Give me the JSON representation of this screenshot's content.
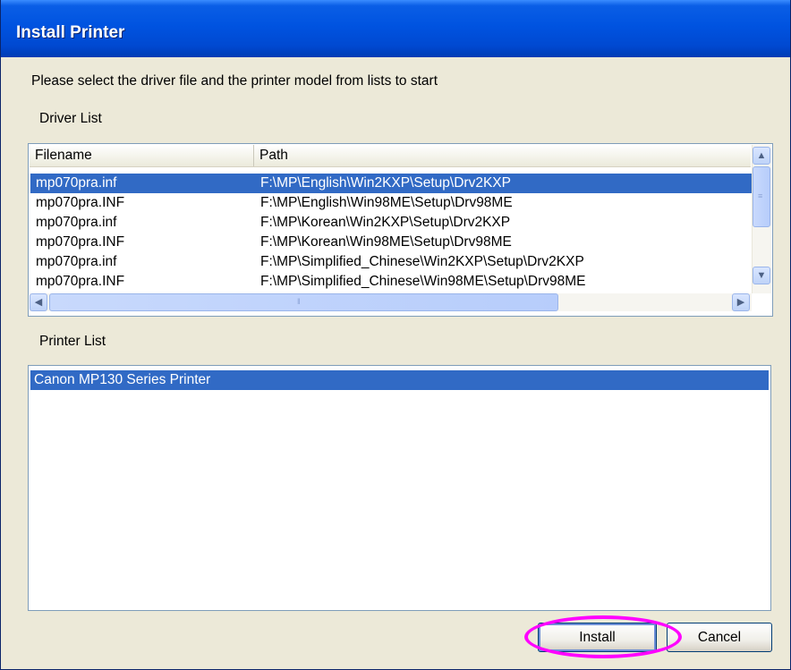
{
  "window": {
    "title": "Install Printer"
  },
  "instruction": "Please select the driver file and the printer model from lists to start",
  "driver_list": {
    "label": "Driver List",
    "columns": [
      "Filename",
      "Path"
    ],
    "rows": [
      {
        "filename": "mp070pra.inf",
        "path": "F:\\MP\\English\\Win2KXP\\Setup\\Drv2KXP",
        "selected": true
      },
      {
        "filename": "mp070pra.INF",
        "path": "F:\\MP\\English\\Win98ME\\Setup\\Drv98ME",
        "selected": false
      },
      {
        "filename": "mp070pra.inf",
        "path": "F:\\MP\\Korean\\Win2KXP\\Setup\\Drv2KXP",
        "selected": false
      },
      {
        "filename": "mp070pra.INF",
        "path": "F:\\MP\\Korean\\Win98ME\\Setup\\Drv98ME",
        "selected": false
      },
      {
        "filename": "mp070pra.inf",
        "path": "F:\\MP\\Simplified_Chinese\\Win2KXP\\Setup\\Drv2KXP",
        "selected": false
      },
      {
        "filename": "mp070pra.INF",
        "path": "F:\\MP\\Simplified_Chinese\\Win98ME\\Setup\\Drv98ME",
        "selected": false
      }
    ]
  },
  "printer_list": {
    "label": "Printer List",
    "items": [
      "Canon MP130 Series Printer"
    ],
    "selected_index": 0
  },
  "buttons": {
    "install": "Install",
    "cancel": "Cancel"
  },
  "colors": {
    "title_bar": "#0053E0",
    "selection": "#316AC5",
    "dialog_bg": "#ECE9D8",
    "highlight_ring": "#FF00FF"
  }
}
